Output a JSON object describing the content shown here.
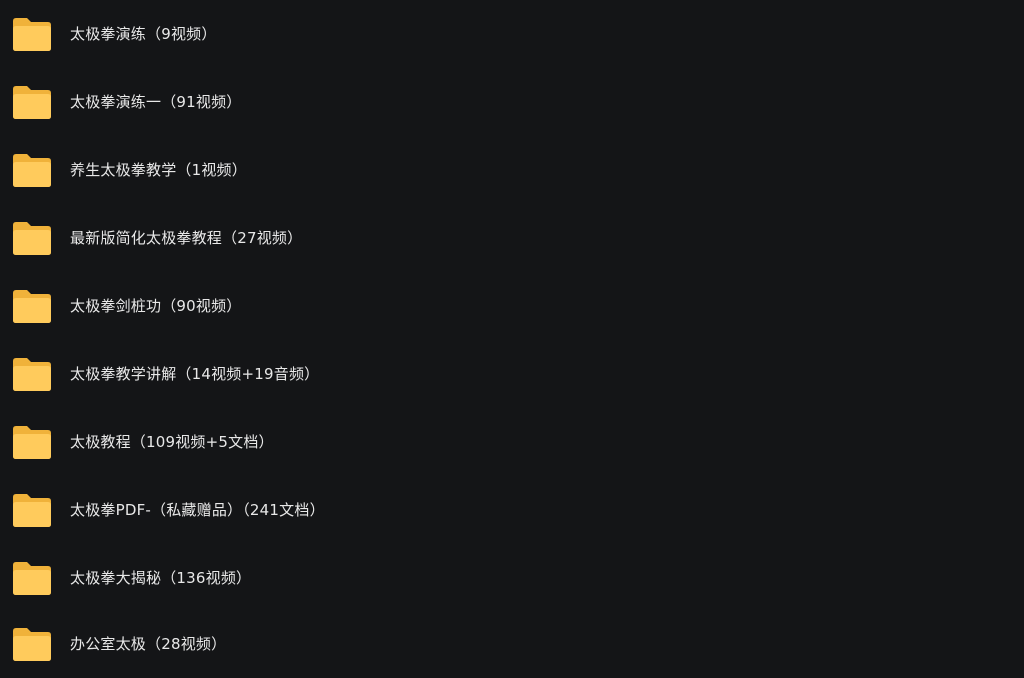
{
  "folder_list": {
    "items": [
      {
        "label": "太极拳演练（9视频）",
        "icon": "folder-icon"
      },
      {
        "label": "太极拳演练一（91视频）",
        "icon": "folder-icon"
      },
      {
        "label": "养生太极拳教学（1视频）",
        "icon": "folder-icon"
      },
      {
        "label": "最新版简化太极拳教程（27视频）",
        "icon": "folder-icon"
      },
      {
        "label": "太极拳剑桩功（90视频）",
        "icon": "folder-icon"
      },
      {
        "label": "太极拳教学讲解（14视频+19音频）",
        "icon": "folder-icon"
      },
      {
        "label": "太极教程（109视频+5文档）",
        "icon": "folder-icon"
      },
      {
        "label": "太极拳PDF-（私藏赠品）（241文档）",
        "icon": "folder-icon"
      },
      {
        "label": "太极拳大揭秘（136视频）",
        "icon": "folder-icon"
      },
      {
        "label": "办公室太极（28视频）",
        "icon": "folder-icon"
      }
    ]
  },
  "colors": {
    "background": "#141517",
    "text": "#e8e8e8",
    "folder_back": "#F5B940",
    "folder_front": "#FFCB5C"
  }
}
